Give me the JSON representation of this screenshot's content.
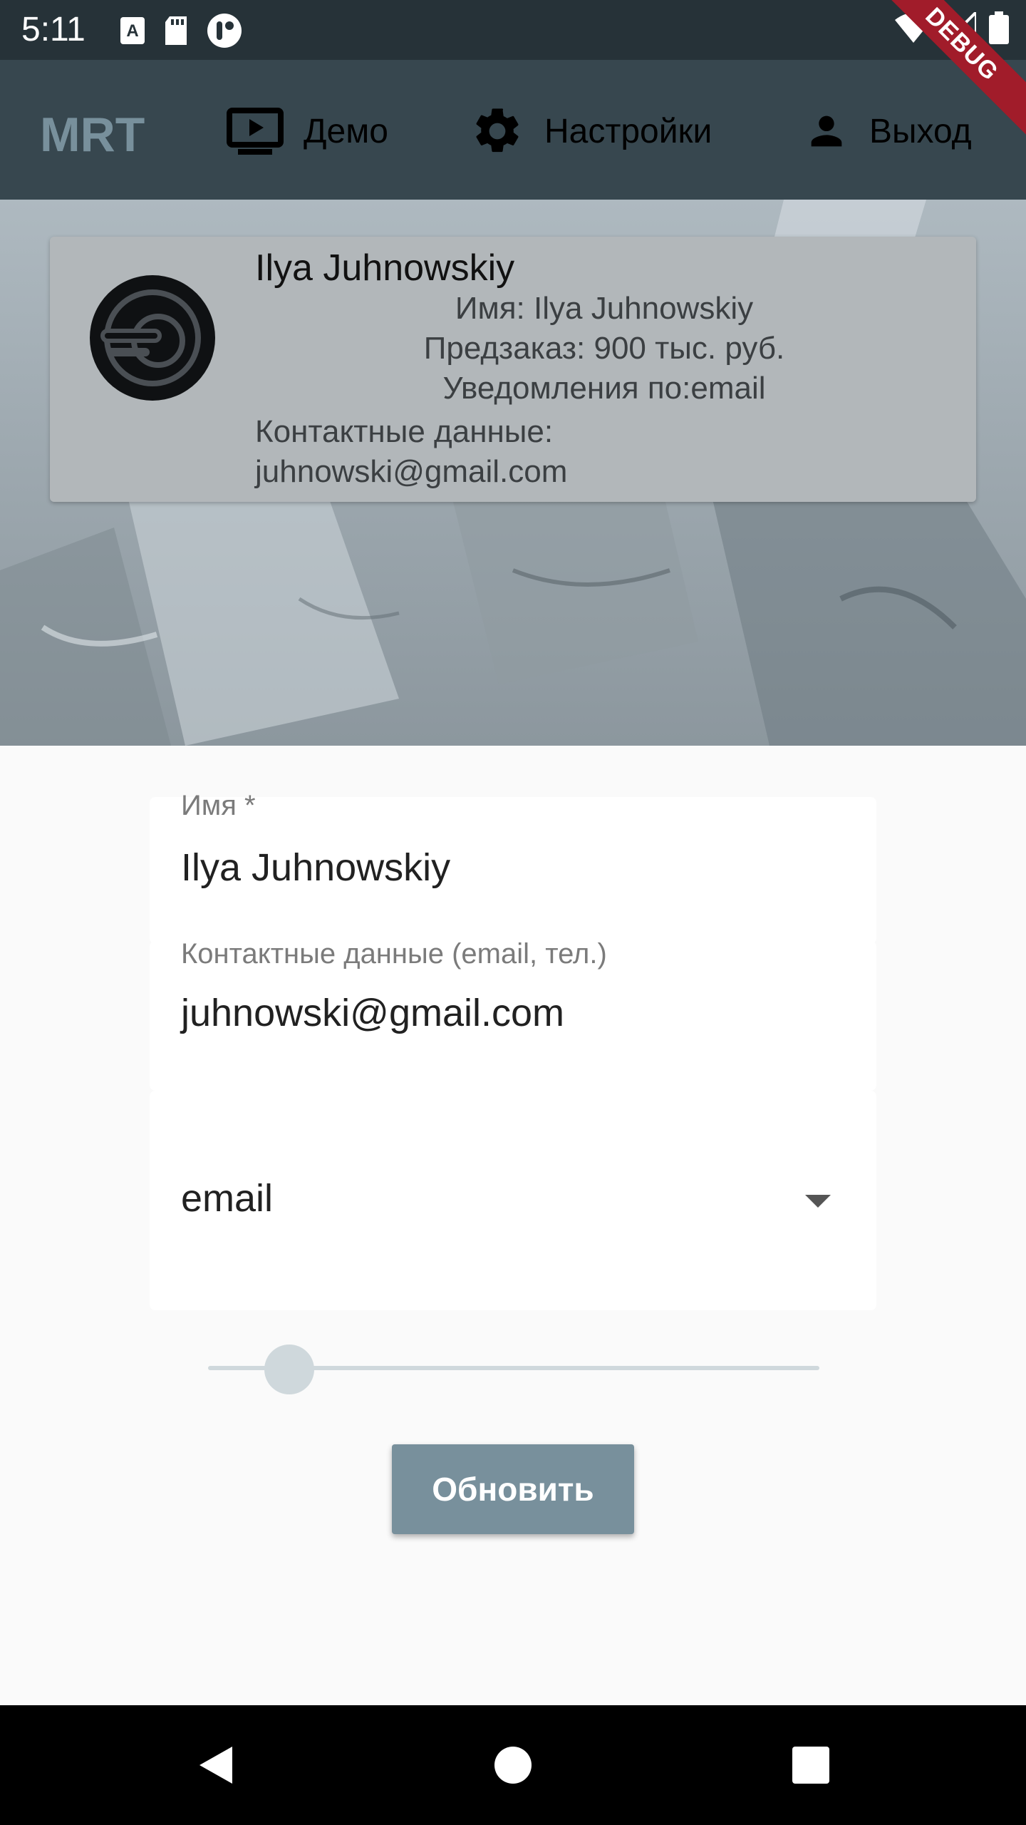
{
  "status_bar": {
    "time": "5:11"
  },
  "debug_banner": "DEBUG",
  "app_bar": {
    "title": "MRT",
    "nav": {
      "demo": {
        "label": "Демо",
        "icon": "tv-play-icon"
      },
      "settings": {
        "label": "Настройки",
        "icon": "gear-icon"
      },
      "logout": {
        "label": "Выход",
        "icon": "person-icon"
      }
    }
  },
  "profile": {
    "name": "Ilya Juhnowskiy",
    "name_line": "Имя: Ilya Juhnowskiy",
    "preorder_line": "Предзаказ: 900 тыс. руб.",
    "notifications_line": "Уведомления по:email",
    "contacts_label": "Контактные данные:",
    "contacts_value": "juhnowski@gmail.com"
  },
  "form": {
    "name_field": {
      "label": "Имя *",
      "value": "Ilya Juhnowskiy"
    },
    "contacts_field": {
      "label": "Контактные данные (email, тел.)",
      "value": "juhnowski@gmail.com"
    },
    "notification_select": {
      "value": "email"
    },
    "slider": {
      "value_fraction": 0.1
    },
    "update_button": "Обновить"
  },
  "colors": {
    "status_bar": "#263238",
    "app_bar": "#37474f",
    "accent": "#78909c"
  }
}
